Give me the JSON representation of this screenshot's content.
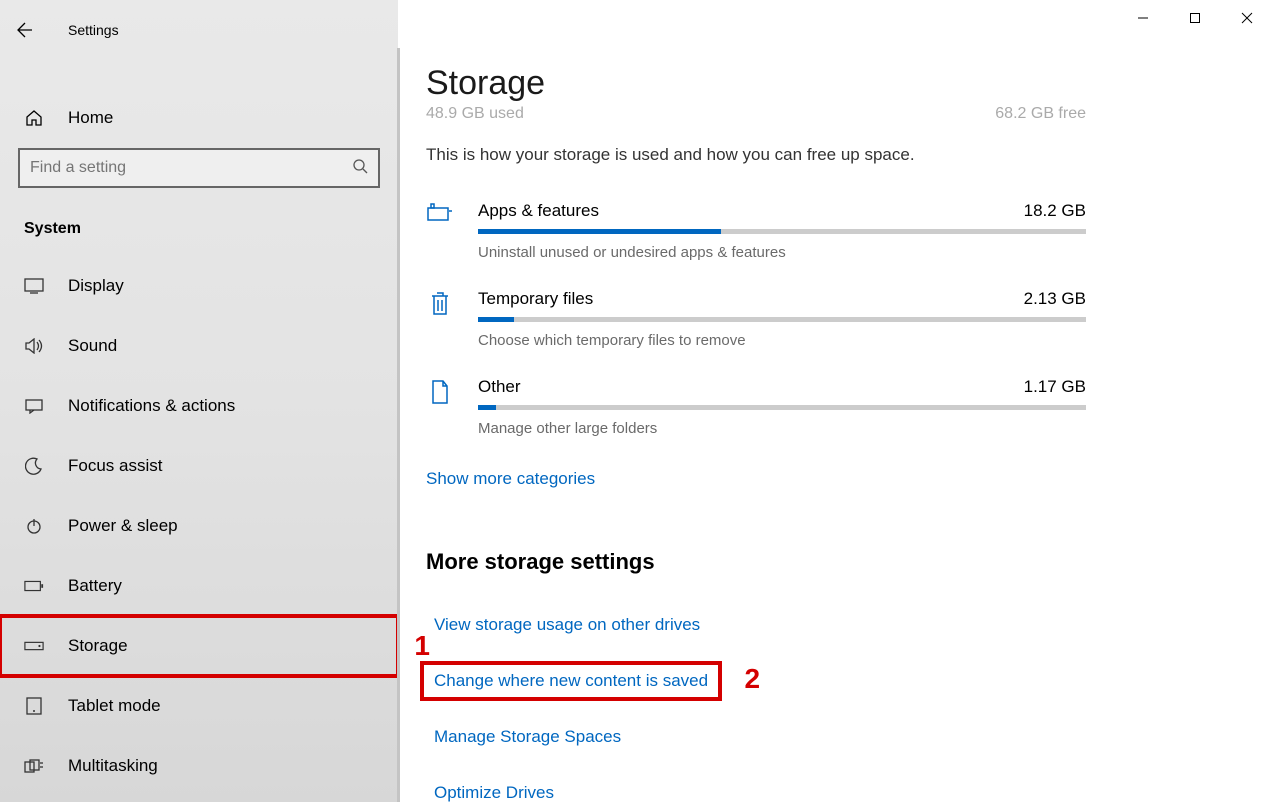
{
  "window": {
    "title": "Settings"
  },
  "sidebar": {
    "home": "Home",
    "search_placeholder": "Find a setting",
    "category": "System",
    "items": [
      {
        "label": "Display",
        "icon": "display"
      },
      {
        "label": "Sound",
        "icon": "sound"
      },
      {
        "label": "Notifications & actions",
        "icon": "notifications"
      },
      {
        "label": "Focus assist",
        "icon": "moon"
      },
      {
        "label": "Power & sleep",
        "icon": "power"
      },
      {
        "label": "Battery",
        "icon": "battery"
      },
      {
        "label": "Storage",
        "icon": "storage",
        "selected": true
      },
      {
        "label": "Tablet mode",
        "icon": "tablet"
      },
      {
        "label": "Multitasking",
        "icon": "multitask"
      }
    ]
  },
  "main": {
    "page_title": "Storage",
    "usage_used": "48.9 GB used",
    "usage_free": "68.2 GB free",
    "intro": "This is how your storage is used and how you can free up space.",
    "categories": [
      {
        "name": "Apps & features",
        "size": "18.2 GB",
        "hint": "Uninstall unused or undesired apps & features",
        "pct": 40,
        "icon": "apps"
      },
      {
        "name": "Temporary files",
        "size": "2.13 GB",
        "hint": "Choose which temporary files to remove",
        "pct": 6,
        "icon": "trash"
      },
      {
        "name": "Other",
        "size": "1.17 GB",
        "hint": "Manage other large folders",
        "pct": 3,
        "icon": "doc"
      }
    ],
    "show_more": "Show more categories",
    "more_title": "More storage settings",
    "more_links": [
      "View storage usage on other drives",
      "Change where new content is saved",
      "Manage Storage Spaces",
      "Optimize Drives"
    ]
  },
  "annotations": {
    "one": "1",
    "two": "2"
  }
}
